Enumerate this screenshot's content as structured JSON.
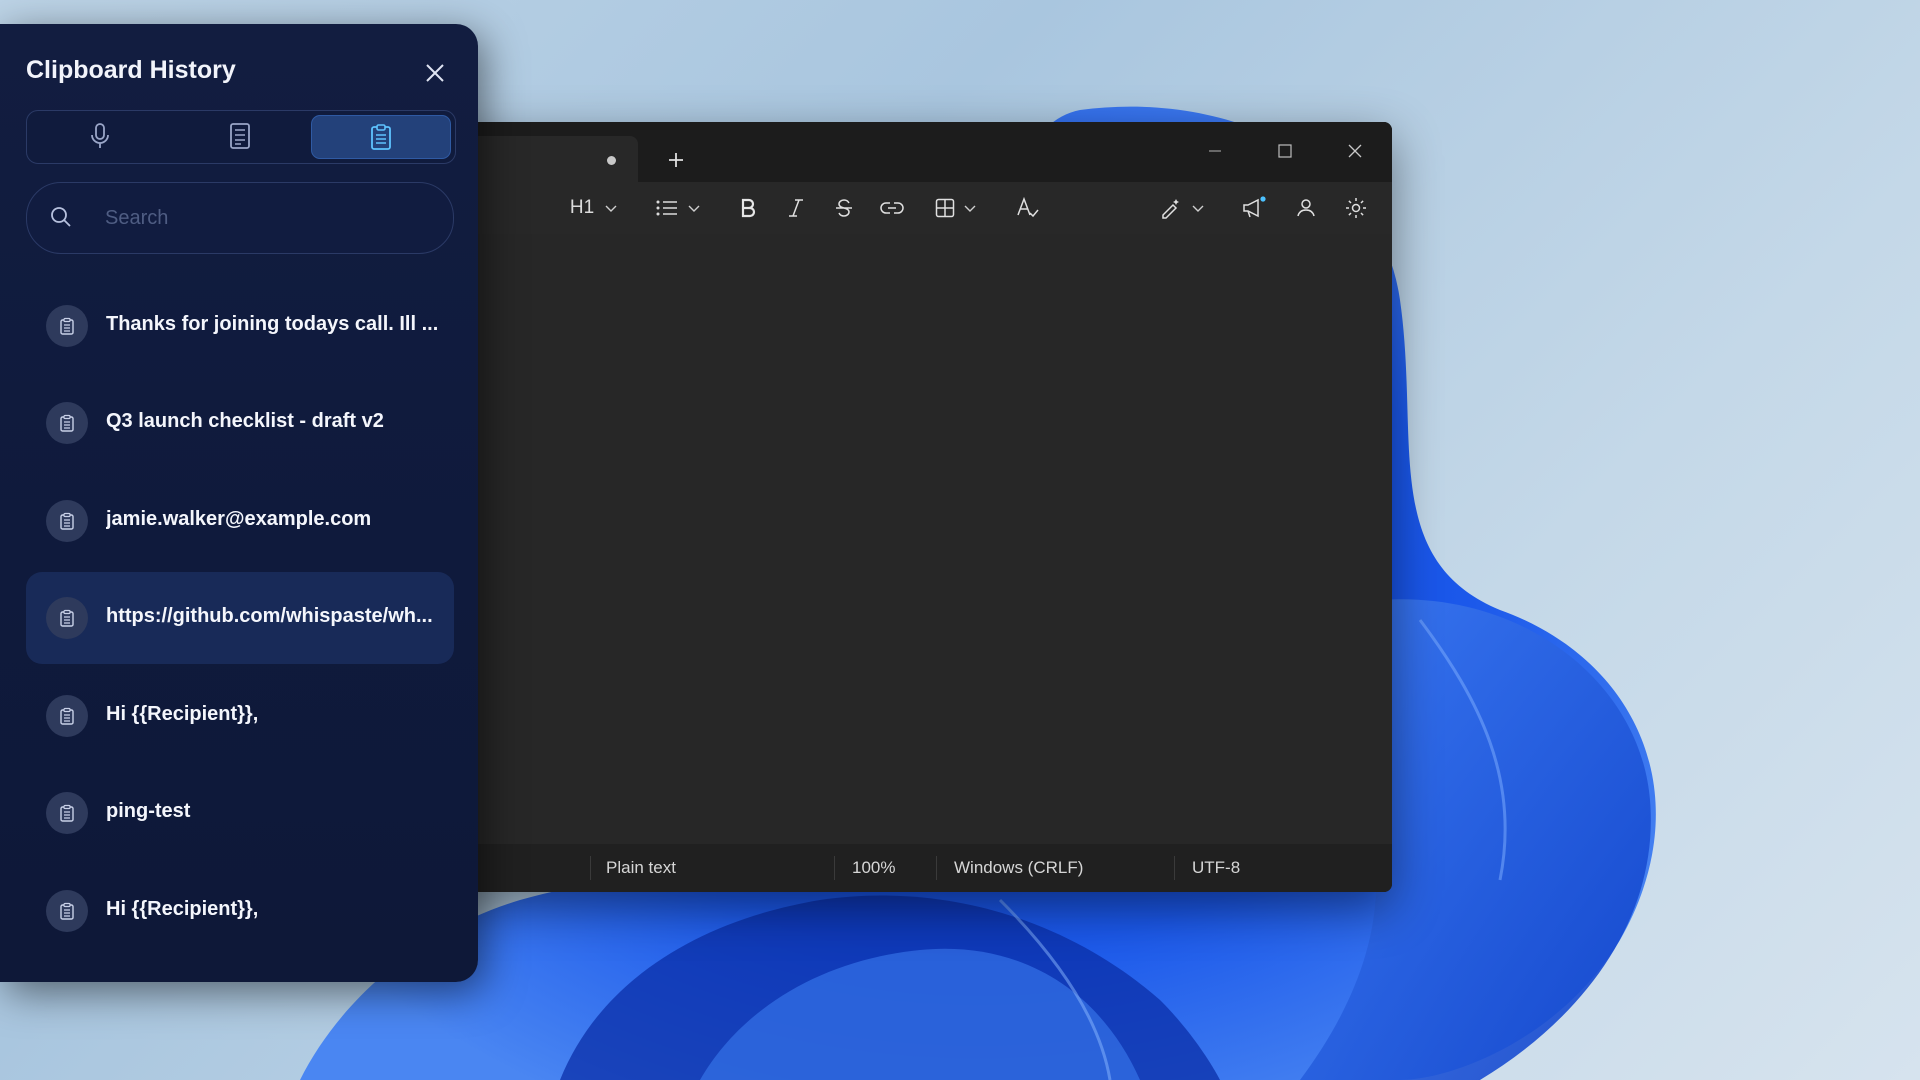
{
  "desktop": {
    "wallpaper_icon": "windows-bloom-wallpaper"
  },
  "notepad": {
    "toolbar": {
      "heading_label": "H1"
    },
    "status": {
      "format": "Plain text",
      "zoom": "100%",
      "line_ending": "Windows (CRLF)",
      "encoding": "UTF-8"
    }
  },
  "clipboard_panel": {
    "title": "Clipboard History",
    "tabs": [
      {
        "icon": "microphone-icon"
      },
      {
        "icon": "notes-icon"
      },
      {
        "icon": "clipboard-icon",
        "active": true
      }
    ],
    "search": {
      "placeholder": "Search",
      "value": ""
    },
    "items": [
      {
        "text": "Thanks for joining todays call. Ill ..."
      },
      {
        "text": "Q3 launch checklist - draft v2"
      },
      {
        "text": "jamie.walker@example.com"
      },
      {
        "text": "https://github.com/whispaste/wh...",
        "selected": true
      },
      {
        "text": "Hi {{Recipient}},"
      },
      {
        "text": "ping-test"
      },
      {
        "text": "Hi {{Recipient}},"
      }
    ]
  },
  "colors": {
    "panel_bg": "#121d40",
    "accent": "#2f5aa3",
    "notepad_bg": "#272727"
  }
}
